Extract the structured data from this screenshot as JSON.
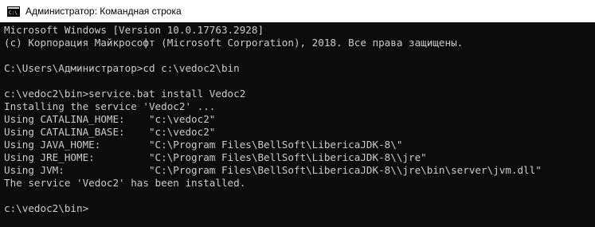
{
  "window": {
    "title": "Администратор: Командная строка",
    "icon": "cmd-icon"
  },
  "colors": {
    "background": "#0c0c0c",
    "text": "#cccccc",
    "titlebar": "#ffffff"
  },
  "console": {
    "lines": [
      "Microsoft Windows [Version 10.0.17763.2928]",
      "(c) Корпорация Майкрософт (Microsoft Corporation), 2018. Все права защищены.",
      "",
      "C:\\Users\\Администратор>cd c:\\vedoc2\\bin",
      "",
      "c:\\vedoc2\\bin>service.bat install Vedoc2",
      "Installing the service 'Vedoc2' ...",
      "Using CATALINA_HOME:    \"c:\\vedoc2\"",
      "Using CATALINA_BASE:    \"c:\\vedoc2\"",
      "Using JAVA_HOME:        \"C:\\Program Files\\BellSoft\\LibericaJDK-8\\\"",
      "Using JRE_HOME:         \"C:\\Program Files\\BellSoft\\LibericaJDK-8\\\\jre\"",
      "Using JVM:              \"C:\\Program Files\\BellSoft\\LibericaJDK-8\\\\jre\\bin\\server\\jvm.dll\"",
      "The service 'Vedoc2' has been installed.",
      "",
      "c:\\vedoc2\\bin>"
    ]
  }
}
